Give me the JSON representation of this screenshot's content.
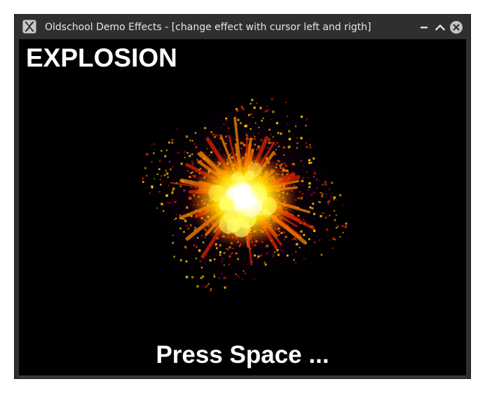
{
  "window": {
    "title": "Oldschool Demo Effects - [change effect with cursor left and rigth]",
    "app_icon": "x11-app-icon",
    "controls": {
      "minimize_icon": "minimize-icon",
      "maximize_icon": "maximize-icon",
      "close_icon": "close-icon"
    }
  },
  "canvas": {
    "effect_name": "EXPLOSION",
    "prompt": "Press Space ...",
    "background_color": "#000000",
    "effect_colors": [
      "#ffffff",
      "#ffff66",
      "#ffcc00",
      "#ff8800",
      "#dd2200",
      "#660022",
      "#220033"
    ]
  }
}
